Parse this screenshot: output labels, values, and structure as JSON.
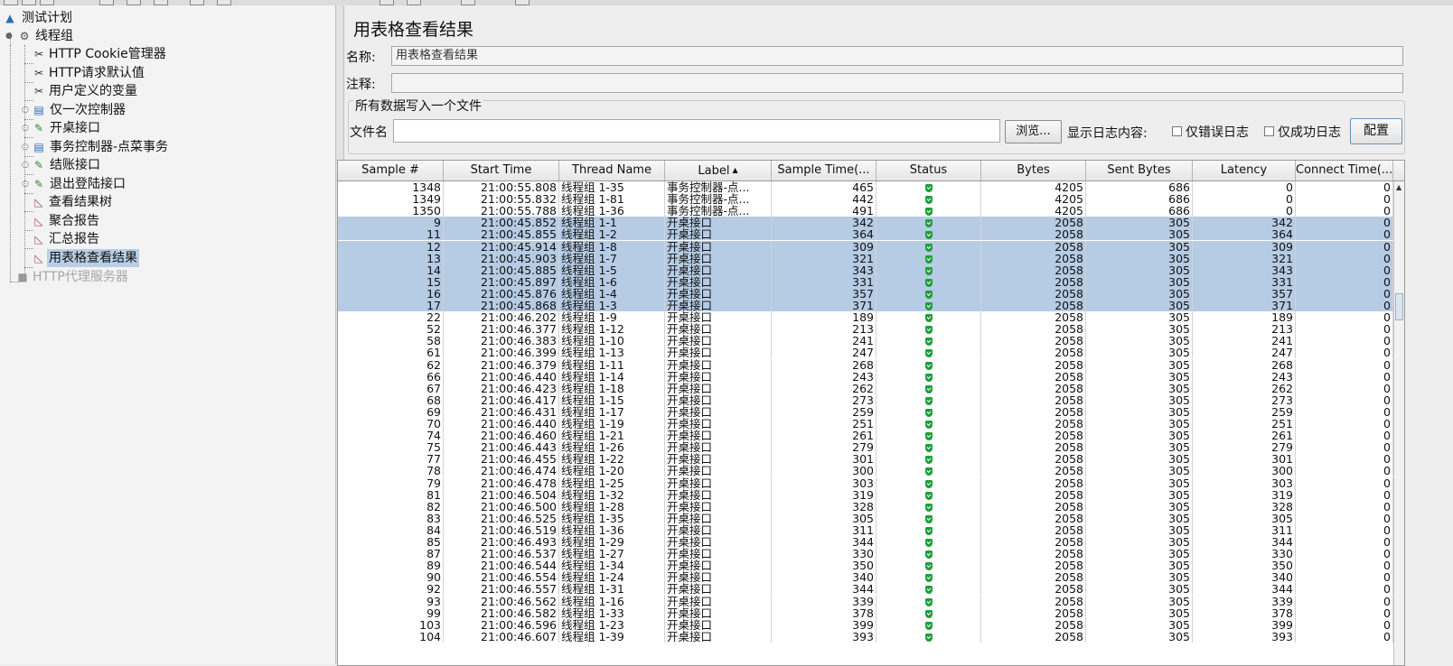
{
  "tree": {
    "items": [
      {
        "label": "测试计划",
        "icon": "test-plan-icon"
      },
      {
        "label": "线程组",
        "icon": "thread-group-gear-icon"
      },
      {
        "label": "HTTP Cookie管理器",
        "icon": "config-element-scissors-icon"
      },
      {
        "label": "HTTP请求默认值",
        "icon": "config-element-scissors-icon"
      },
      {
        "label": "用户定义的变量",
        "icon": "config-element-scissors-icon"
      },
      {
        "label": "仅一次控制器",
        "icon": "logic-controller-icon"
      },
      {
        "label": "开桌接口",
        "icon": "sampler-pipette-icon"
      },
      {
        "label": "事务控制器-点菜事务",
        "icon": "logic-controller-icon"
      },
      {
        "label": "结账接口",
        "icon": "sampler-pipette-icon"
      },
      {
        "label": "退出登陆接口",
        "icon": "sampler-pipette-icon"
      },
      {
        "label": "查看结果树",
        "icon": "listener-chart-icon"
      },
      {
        "label": "聚合报告",
        "icon": "listener-chart-icon"
      },
      {
        "label": "汇总报告",
        "icon": "listener-chart-icon"
      },
      {
        "label": "用表格查看结果",
        "icon": "listener-chart-icon"
      },
      {
        "label": "HTTP代理服务器",
        "icon": "proxy-server-icon"
      }
    ]
  },
  "panel": {
    "title": "用表格查看结果",
    "name_label": "名称:",
    "name_value": "用表格查看结果",
    "comment_label": "注释:",
    "comment_value": "",
    "file_group_title": "所有数据写入一个文件",
    "filename_label": "文件名",
    "filename_value": "",
    "browse_label": "浏览...",
    "log_display_label": "显示日志内容:",
    "errors_only_label": "仅错误日志",
    "success_only_label": "仅成功日志",
    "configure_label": "配置"
  },
  "table": {
    "columns": [
      "Sample #",
      "Start Time",
      "Thread Name",
      "Label",
      "Sample Time(...",
      "Status",
      "Bytes",
      "Sent Bytes",
      "Latency",
      "Connect Time(..."
    ],
    "sorted_column": "Label",
    "sort_indicator": "▲",
    "status_color": "#1f9e3a",
    "selection_color": "#b6cbe4",
    "rows": [
      {
        "n": "1348",
        "t": "21:00:55.808",
        "th": "线程组 1-35",
        "l": "事务控制器-点...",
        "st": "465",
        "b": "4205",
        "sb": "686",
        "lat": "0",
        "ct": "0",
        "sel": false
      },
      {
        "n": "1349",
        "t": "21:00:55.832",
        "th": "线程组 1-81",
        "l": "事务控制器-点...",
        "st": "442",
        "b": "4205",
        "sb": "686",
        "lat": "0",
        "ct": "0",
        "sel": false
      },
      {
        "n": "1350",
        "t": "21:00:55.788",
        "th": "线程组 1-36",
        "l": "事务控制器-点...",
        "st": "491",
        "b": "4205",
        "sb": "686",
        "lat": "0",
        "ct": "0",
        "sel": false
      },
      {
        "n": "9",
        "t": "21:00:45.852",
        "th": "线程组 1-1",
        "l": "开桌接口",
        "st": "342",
        "b": "2058",
        "sb": "305",
        "lat": "342",
        "ct": "0",
        "sel": true
      },
      {
        "n": "11",
        "t": "21:00:45.855",
        "th": "线程组 1-2",
        "l": "开桌接口",
        "st": "364",
        "b": "2058",
        "sb": "305",
        "lat": "364",
        "ct": "0",
        "sel": true
      },
      {
        "n": "12",
        "t": "21:00:45.914",
        "th": "线程组 1-8",
        "l": "开桌接口",
        "st": "309",
        "b": "2058",
        "sb": "305",
        "lat": "309",
        "ct": "0",
        "sel": true
      },
      {
        "n": "13",
        "t": "21:00:45.903",
        "th": "线程组 1-7",
        "l": "开桌接口",
        "st": "321",
        "b": "2058",
        "sb": "305",
        "lat": "321",
        "ct": "0",
        "sel": true
      },
      {
        "n": "14",
        "t": "21:00:45.885",
        "th": "线程组 1-5",
        "l": "开桌接口",
        "st": "343",
        "b": "2058",
        "sb": "305",
        "lat": "343",
        "ct": "0",
        "sel": true
      },
      {
        "n": "15",
        "t": "21:00:45.897",
        "th": "线程组 1-6",
        "l": "开桌接口",
        "st": "331",
        "b": "2058",
        "sb": "305",
        "lat": "331",
        "ct": "0",
        "sel": true
      },
      {
        "n": "16",
        "t": "21:00:45.876",
        "th": "线程组 1-4",
        "l": "开桌接口",
        "st": "357",
        "b": "2058",
        "sb": "305",
        "lat": "357",
        "ct": "0",
        "sel": true
      },
      {
        "n": "17",
        "t": "21:00:45.868",
        "th": "线程组 1-3",
        "l": "开桌接口",
        "st": "371",
        "b": "2058",
        "sb": "305",
        "lat": "371",
        "ct": "0",
        "sel": true
      },
      {
        "n": "22",
        "t": "21:00:46.202",
        "th": "线程组 1-9",
        "l": "开桌接口",
        "st": "189",
        "b": "2058",
        "sb": "305",
        "lat": "189",
        "ct": "0",
        "sel": false
      },
      {
        "n": "52",
        "t": "21:00:46.377",
        "th": "线程组 1-12",
        "l": "开桌接口",
        "st": "213",
        "b": "2058",
        "sb": "305",
        "lat": "213",
        "ct": "0",
        "sel": false
      },
      {
        "n": "58",
        "t": "21:00:46.383",
        "th": "线程组 1-10",
        "l": "开桌接口",
        "st": "241",
        "b": "2058",
        "sb": "305",
        "lat": "241",
        "ct": "0",
        "sel": false
      },
      {
        "n": "61",
        "t": "21:00:46.399",
        "th": "线程组 1-13",
        "l": "开桌接口",
        "st": "247",
        "b": "2058",
        "sb": "305",
        "lat": "247",
        "ct": "0",
        "sel": false
      },
      {
        "n": "62",
        "t": "21:00:46.379",
        "th": "线程组 1-11",
        "l": "开桌接口",
        "st": "268",
        "b": "2058",
        "sb": "305",
        "lat": "268",
        "ct": "0",
        "sel": false
      },
      {
        "n": "66",
        "t": "21:00:46.440",
        "th": "线程组 1-14",
        "l": "开桌接口",
        "st": "243",
        "b": "2058",
        "sb": "305",
        "lat": "243",
        "ct": "0",
        "sel": false
      },
      {
        "n": "67",
        "t": "21:00:46.423",
        "th": "线程组 1-18",
        "l": "开桌接口",
        "st": "262",
        "b": "2058",
        "sb": "305",
        "lat": "262",
        "ct": "0",
        "sel": false
      },
      {
        "n": "68",
        "t": "21:00:46.417",
        "th": "线程组 1-15",
        "l": "开桌接口",
        "st": "273",
        "b": "2058",
        "sb": "305",
        "lat": "273",
        "ct": "0",
        "sel": false
      },
      {
        "n": "69",
        "t": "21:00:46.431",
        "th": "线程组 1-17",
        "l": "开桌接口",
        "st": "259",
        "b": "2058",
        "sb": "305",
        "lat": "259",
        "ct": "0",
        "sel": false
      },
      {
        "n": "70",
        "t": "21:00:46.440",
        "th": "线程组 1-19",
        "l": "开桌接口",
        "st": "251",
        "b": "2058",
        "sb": "305",
        "lat": "251",
        "ct": "0",
        "sel": false
      },
      {
        "n": "74",
        "t": "21:00:46.460",
        "th": "线程组 1-21",
        "l": "开桌接口",
        "st": "261",
        "b": "2058",
        "sb": "305",
        "lat": "261",
        "ct": "0",
        "sel": false
      },
      {
        "n": "75",
        "t": "21:00:46.443",
        "th": "线程组 1-26",
        "l": "开桌接口",
        "st": "279",
        "b": "2058",
        "sb": "305",
        "lat": "279",
        "ct": "0",
        "sel": false
      },
      {
        "n": "77",
        "t": "21:00:46.455",
        "th": "线程组 1-22",
        "l": "开桌接口",
        "st": "301",
        "b": "2058",
        "sb": "305",
        "lat": "301",
        "ct": "0",
        "sel": false
      },
      {
        "n": "78",
        "t": "21:00:46.474",
        "th": "线程组 1-20",
        "l": "开桌接口",
        "st": "300",
        "b": "2058",
        "sb": "305",
        "lat": "300",
        "ct": "0",
        "sel": false
      },
      {
        "n": "79",
        "t": "21:00:46.478",
        "th": "线程组 1-25",
        "l": "开桌接口",
        "st": "303",
        "b": "2058",
        "sb": "305",
        "lat": "303",
        "ct": "0",
        "sel": false
      },
      {
        "n": "81",
        "t": "21:00:46.504",
        "th": "线程组 1-32",
        "l": "开桌接口",
        "st": "319",
        "b": "2058",
        "sb": "305",
        "lat": "319",
        "ct": "0",
        "sel": false
      },
      {
        "n": "82",
        "t": "21:00:46.500",
        "th": "线程组 1-28",
        "l": "开桌接口",
        "st": "328",
        "b": "2058",
        "sb": "305",
        "lat": "328",
        "ct": "0",
        "sel": false
      },
      {
        "n": "83",
        "t": "21:00:46.525",
        "th": "线程组 1-35",
        "l": "开桌接口",
        "st": "305",
        "b": "2058",
        "sb": "305",
        "lat": "305",
        "ct": "0",
        "sel": false
      },
      {
        "n": "84",
        "t": "21:00:46.519",
        "th": "线程组 1-36",
        "l": "开桌接口",
        "st": "311",
        "b": "2058",
        "sb": "305",
        "lat": "311",
        "ct": "0",
        "sel": false
      },
      {
        "n": "85",
        "t": "21:00:46.493",
        "th": "线程组 1-29",
        "l": "开桌接口",
        "st": "344",
        "b": "2058",
        "sb": "305",
        "lat": "344",
        "ct": "0",
        "sel": false
      },
      {
        "n": "87",
        "t": "21:00:46.537",
        "th": "线程组 1-27",
        "l": "开桌接口",
        "st": "330",
        "b": "2058",
        "sb": "305",
        "lat": "330",
        "ct": "0",
        "sel": false
      },
      {
        "n": "89",
        "t": "21:00:46.544",
        "th": "线程组 1-34",
        "l": "开桌接口",
        "st": "350",
        "b": "2058",
        "sb": "305",
        "lat": "350",
        "ct": "0",
        "sel": false
      },
      {
        "n": "90",
        "t": "21:00:46.554",
        "th": "线程组 1-24",
        "l": "开桌接口",
        "st": "340",
        "b": "2058",
        "sb": "305",
        "lat": "340",
        "ct": "0",
        "sel": false
      },
      {
        "n": "92",
        "t": "21:00:46.557",
        "th": "线程组 1-31",
        "l": "开桌接口",
        "st": "344",
        "b": "2058",
        "sb": "305",
        "lat": "344",
        "ct": "0",
        "sel": false
      },
      {
        "n": "93",
        "t": "21:00:46.562",
        "th": "线程组 1-16",
        "l": "开桌接口",
        "st": "339",
        "b": "2058",
        "sb": "305",
        "lat": "339",
        "ct": "0",
        "sel": false
      },
      {
        "n": "99",
        "t": "21:00:46.582",
        "th": "线程组 1-33",
        "l": "开桌接口",
        "st": "378",
        "b": "2058",
        "sb": "305",
        "lat": "378",
        "ct": "0",
        "sel": false
      },
      {
        "n": "103",
        "t": "21:00:46.596",
        "th": "线程组 1-23",
        "l": "开桌接口",
        "st": "399",
        "b": "2058",
        "sb": "305",
        "lat": "399",
        "ct": "0",
        "sel": false
      },
      {
        "n": "104",
        "t": "21:00:46.607",
        "th": "线程组 1-39",
        "l": "开桌接口",
        "st": "393",
        "b": "2058",
        "sb": "305",
        "lat": "393",
        "ct": "0",
        "sel": false
      }
    ]
  }
}
